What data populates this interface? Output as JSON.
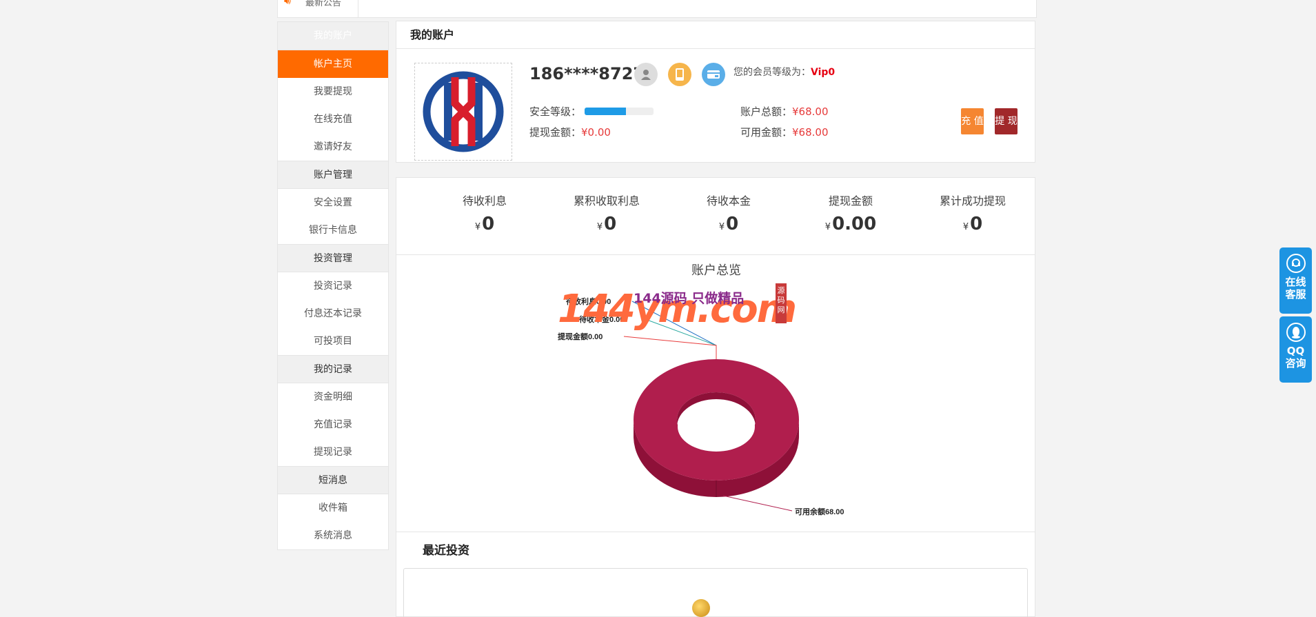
{
  "announce": {
    "label": "最新公告"
  },
  "sidebar": {
    "groups": [
      {
        "title": "我的账户",
        "items": [
          "帐户主页",
          "我要提现",
          "在线充值",
          "邀请好友"
        ]
      },
      {
        "title": "账户管理",
        "items": [
          "安全设置",
          "银行卡信息"
        ]
      },
      {
        "title": "投资管理",
        "items": [
          "投资记录",
          "付息还本记录",
          "可投项目"
        ]
      },
      {
        "title": "我的记录",
        "items": [
          "资金明细",
          "充值记录",
          "提现记录"
        ]
      },
      {
        "title": "短消息",
        "items": [
          "收件箱",
          "系统消息"
        ]
      }
    ],
    "active_item": "帐户主页"
  },
  "account": {
    "title": "我的账户",
    "username": "186****8727",
    "vip_label": "您的会员等级为：",
    "vip_level": "Vip0",
    "security_label": "安全等级：",
    "security_level": 0.6,
    "withdraw_label": "提现金额：",
    "withdraw_value": "¥0.00",
    "total_label": "账户总额：",
    "total_value": "¥68.00",
    "available_label": "可用金额：",
    "available_value": "¥68.00",
    "recharge_button": "充 值",
    "withdraw_button": "提 现"
  },
  "stats": [
    {
      "title": "待收利息",
      "currency": "¥",
      "value": "0"
    },
    {
      "title": "累积收取利息",
      "currency": "¥",
      "value": "0"
    },
    {
      "title": "待收本金",
      "currency": "¥",
      "value": "0"
    },
    {
      "title": "提现金额",
      "currency": "¥",
      "value": "0.00"
    },
    {
      "title": "累计成功提现",
      "currency": "¥",
      "value": "0"
    }
  ],
  "watermark": {
    "big": "144ym.com",
    "small": "144源码 只做精品",
    "box": "源码网"
  },
  "chart_data": {
    "type": "pie",
    "title": "账户总览",
    "slices": [
      {
        "label": "待收利息",
        "value": 0.0,
        "display": "待收利息0.00",
        "color": "#1e6fc4"
      },
      {
        "label": "待收本金",
        "value": 0.0,
        "display": "待收本金0.00",
        "color": "#2aa9a0"
      },
      {
        "label": "提现金额",
        "value": 0.0,
        "display": "提现金额0.00",
        "color": "#e83b3b"
      },
      {
        "label": "可用余额",
        "value": 68.0,
        "display": "可用余额68.00",
        "color": "#b01e4d"
      }
    ]
  },
  "recent": {
    "title": "最近投资"
  },
  "float_buttons": [
    {
      "label1": "在线",
      "label2": "客服"
    },
    {
      "label1": "QQ",
      "label2": "咨询"
    }
  ],
  "colors": {
    "accent": "#ff6a00",
    "money": "#e63a3a",
    "float": "#1d94e2"
  }
}
